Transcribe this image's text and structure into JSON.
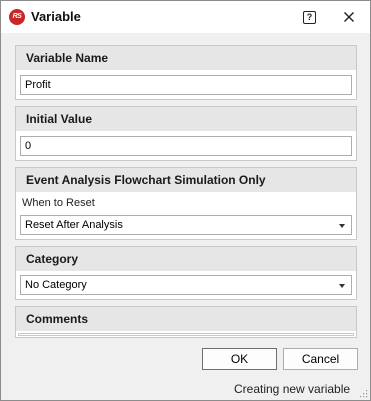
{
  "window": {
    "title": "Variable",
    "logo_text": "RS",
    "help_glyph": "?",
    "close_icon": "close-icon"
  },
  "variable_name": {
    "header": "Variable Name",
    "value": "Profit"
  },
  "initial_value": {
    "header": "Initial Value",
    "value": "0"
  },
  "event_analysis": {
    "header": "Event Analysis Flowchart Simulation Only",
    "when_to_reset_label": "When to Reset",
    "when_to_reset_value": "Reset After Analysis"
  },
  "category": {
    "header": "Category",
    "value": "No Category"
  },
  "comments": {
    "header": "Comments",
    "value": ""
  },
  "buttons": {
    "ok_label": "OK",
    "cancel_label": "Cancel"
  },
  "status": {
    "text": "Creating new variable"
  },
  "colors": {
    "logo_red": "#c62828",
    "header_bg": "#e6e6e6",
    "content_bg": "#f0f0f0"
  }
}
